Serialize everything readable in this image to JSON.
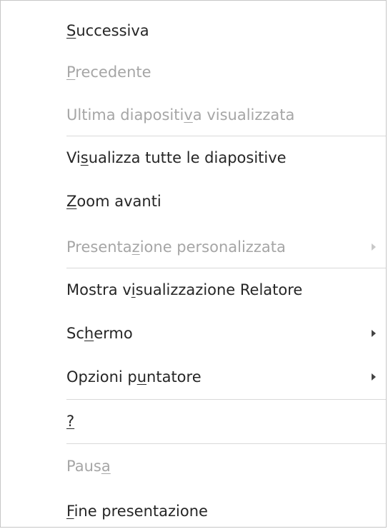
{
  "menu": {
    "successiva": {
      "pre": "",
      "acc": "S",
      "post": "uccessiva",
      "enabled": true
    },
    "precedente": {
      "pre": "",
      "acc": "P",
      "post": "recedente",
      "enabled": false
    },
    "ultima": {
      "pre": "Ultima diapositi",
      "acc": "v",
      "post": "a visualizzata",
      "enabled": false
    },
    "tutte": {
      "pre": "Vi",
      "acc": "s",
      "post": "ualizza tutte le diapositive",
      "enabled": true
    },
    "zoom": {
      "pre": "",
      "acc": "Z",
      "post": "oom avanti",
      "enabled": true
    },
    "personalizzata": {
      "pre": "Presenta",
      "acc": "z",
      "post": "ione personalizzata",
      "enabled": false,
      "submenu": true
    },
    "relatore": {
      "pre": "Mostra v",
      "acc": "i",
      "post": "sualizzazione Relatore",
      "enabled": true
    },
    "schermo": {
      "pre": "Sc",
      "acc": "h",
      "post": "ermo",
      "enabled": true,
      "submenu": true
    },
    "puntatore": {
      "pre": "Opzioni p",
      "acc": "u",
      "post": "ntatore",
      "enabled": true,
      "submenu": true
    },
    "help": {
      "pre": "",
      "acc": "?",
      "post": "",
      "enabled": true
    },
    "pausa": {
      "pre": "Paus",
      "acc": "a",
      "post": "",
      "enabled": false
    },
    "fine": {
      "pre": "",
      "acc": "F",
      "post": "ine presentazione",
      "enabled": true
    }
  },
  "icons": {
    "submenu": "triangle-right-arrow"
  },
  "colors": {
    "text": "#262626",
    "disabled_text": "#a6a6a6",
    "separator": "#d9d9d9",
    "border": "#c6c6c6"
  }
}
